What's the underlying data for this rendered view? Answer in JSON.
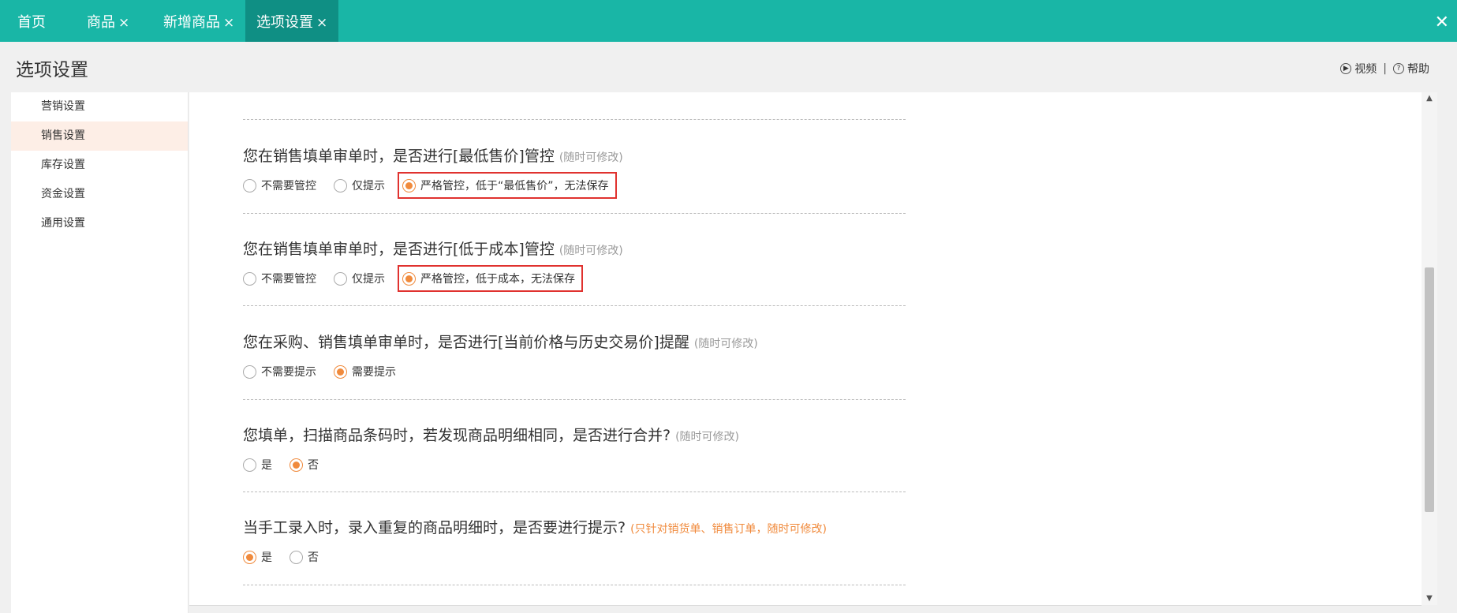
{
  "tabs": [
    {
      "label": "首页",
      "closable": false
    },
    {
      "label": "商品",
      "closable": true
    },
    {
      "label": "新增商品",
      "closable": true
    },
    {
      "label": "选项设置",
      "closable": true,
      "active": true
    }
  ],
  "close_glyph": "×",
  "window_close_glyph": "✕",
  "header": {
    "title": "选项设置",
    "video_label": "视频",
    "help_label": "帮助",
    "separator": "|",
    "video_icon": "▶",
    "help_icon": "?"
  },
  "sidebar": {
    "items": [
      {
        "label": "营销设置",
        "active": false
      },
      {
        "label": "销售设置",
        "active": true
      },
      {
        "label": "库存设置",
        "active": false
      },
      {
        "label": "资金设置",
        "active": false
      },
      {
        "label": "通用设置",
        "active": false
      }
    ]
  },
  "sections": [
    {
      "title": "您在销售填单审单时，是否进行[最低售价]管控",
      "note": "(随时可修改)",
      "options": [
        {
          "label": "不需要管控",
          "checked": false
        },
        {
          "label": "仅提示",
          "checked": false
        },
        {
          "label": "严格管控，低于“最低售价”，无法保存",
          "checked": true,
          "highlighted": true
        }
      ]
    },
    {
      "title": "您在销售填单审单时，是否进行[低于成本]管控",
      "note": "(随时可修改)",
      "options": [
        {
          "label": "不需要管控",
          "checked": false
        },
        {
          "label": "仅提示",
          "checked": false
        },
        {
          "label": "严格管控，低于成本，无法保存",
          "checked": true,
          "highlighted": true
        }
      ]
    },
    {
      "title": "您在采购、销售填单审单时，是否进行[当前价格与历史交易价]提醒",
      "note": "(随时可修改)",
      "options": [
        {
          "label": "不需要提示",
          "checked": false
        },
        {
          "label": "需要提示",
          "checked": true
        }
      ]
    },
    {
      "title": "您填单，扫描商品条码时，若发现商品明细相同，是否进行合并?",
      "note": "(随时可修改)",
      "options": [
        {
          "label": "是",
          "checked": false
        },
        {
          "label": "否",
          "checked": true
        }
      ]
    },
    {
      "title": "当手工录入时，录入重复的商品明细时，是否要进行提示?",
      "note": "(只针对销货单、销售订单，随时可修改)",
      "note_color": "#f08a3c",
      "options": [
        {
          "label": "是",
          "checked": true
        },
        {
          "label": "否",
          "checked": false
        }
      ]
    }
  ],
  "colors": {
    "topbar": "#19b6a6",
    "active_tab": "#0f8f84",
    "accent": "#f08a3c",
    "highlight_border": "#e0322f"
  }
}
